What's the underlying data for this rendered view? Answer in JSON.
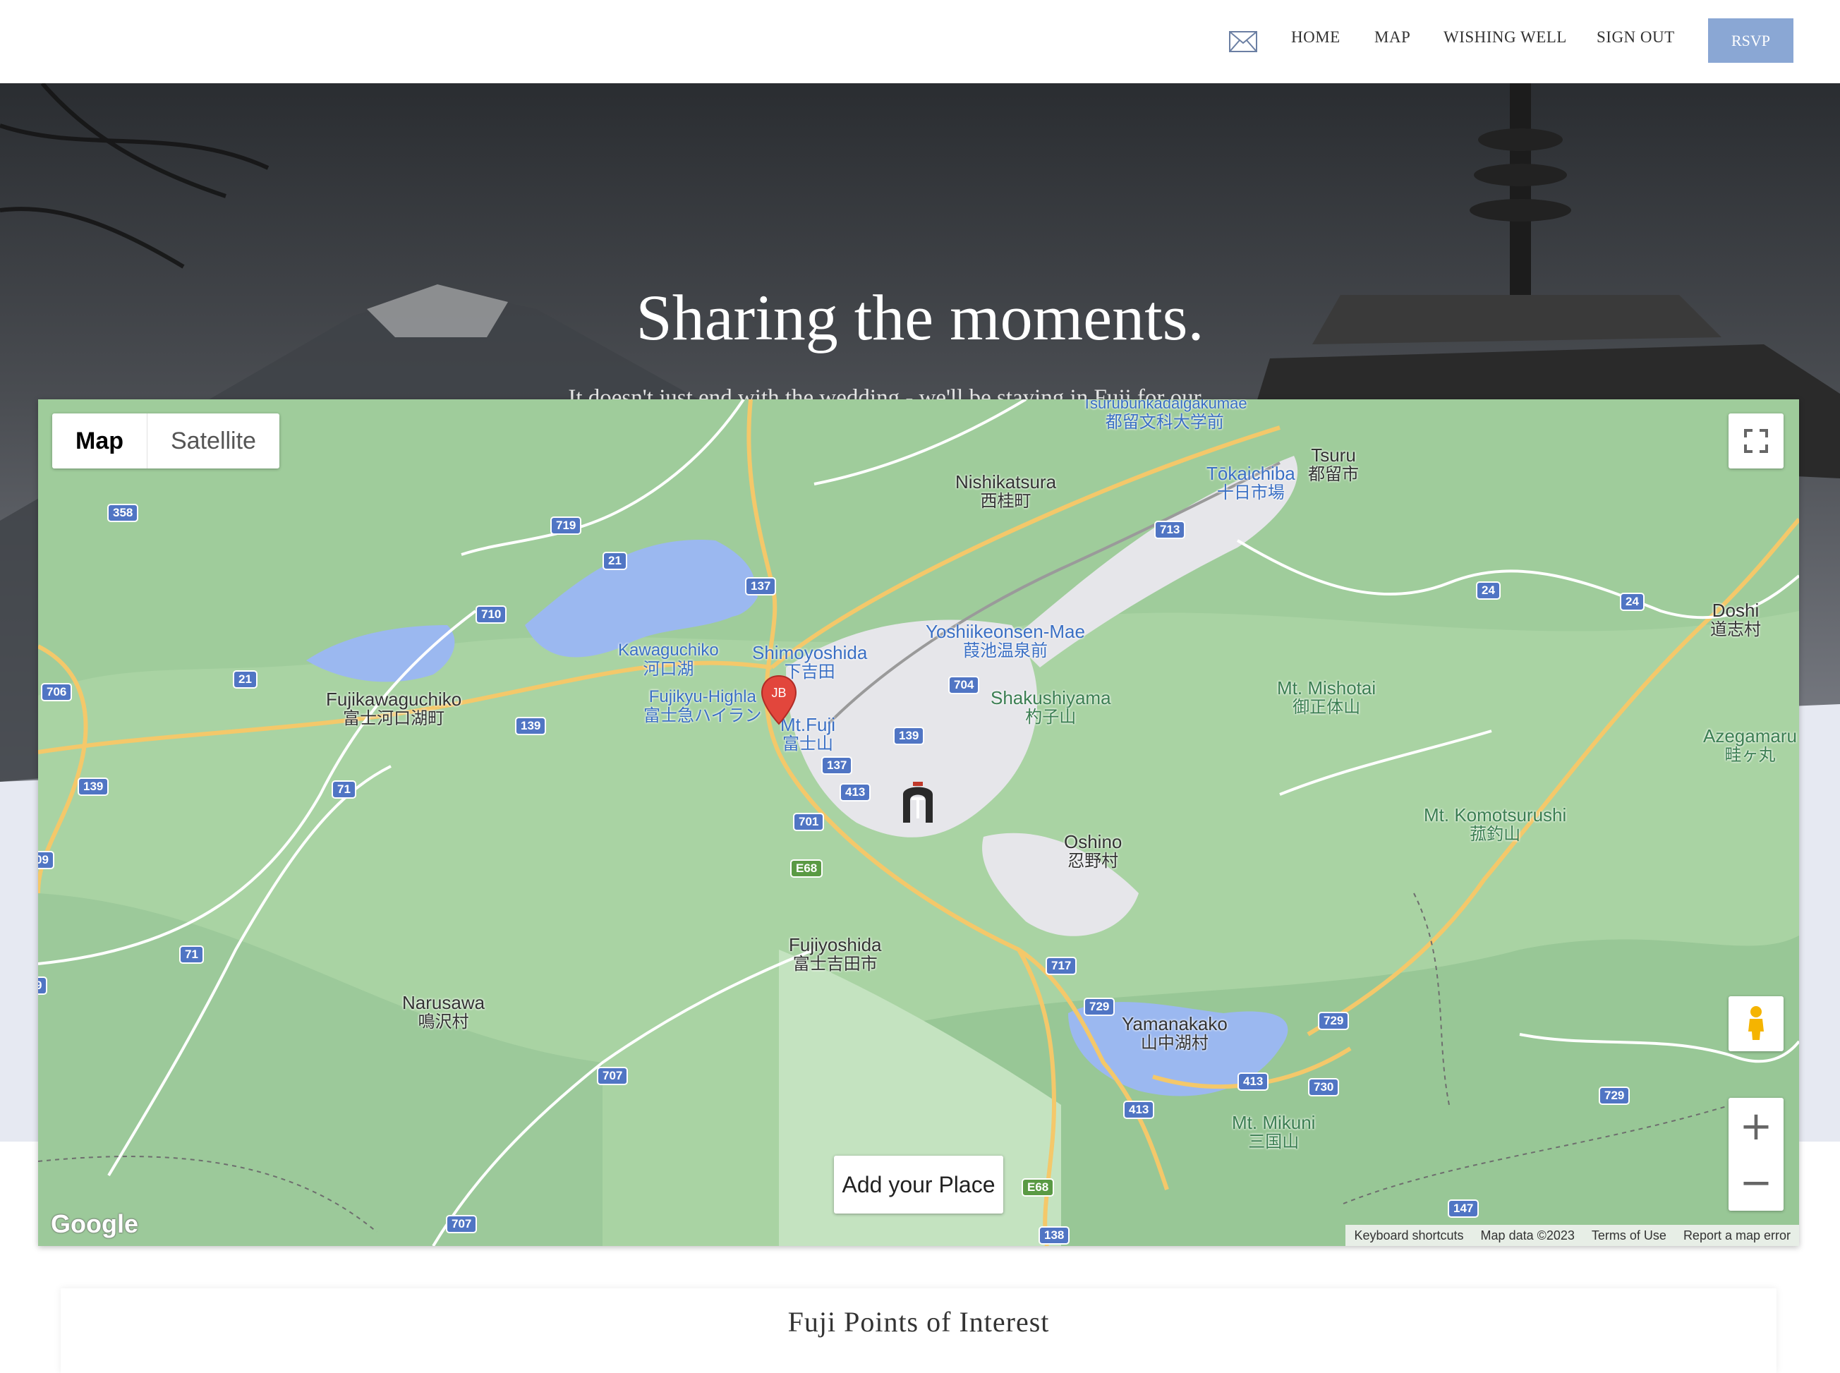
{
  "nav": {
    "mail_icon": "envelope-icon",
    "links": [
      "HOME",
      "MAP",
      "WISHING WELL",
      "SIGN OUT"
    ],
    "rsvp": "RSVP",
    "rsvp_color": "#8aa7d4"
  },
  "hero": {
    "title": "Sharing the moments.",
    "subtitle": "It doesn't just end with the wedding - we'll be staying in Fuji for our honeymoon. Here are our plans throughout our trip in Fuji."
  },
  "map": {
    "type_buttons": {
      "map": "Map",
      "satellite": "Satellite"
    },
    "add_place": "Add your Place",
    "logo": "Google",
    "attribution": [
      "Keyboard shortcuts",
      "Map data ©2023",
      "Terms of Use",
      "Report a map error"
    ],
    "marker_label": "JB",
    "marker_color": "#e2463c",
    "places": [
      {
        "en": "Nishikatsura",
        "jp": "西桂町"
      },
      {
        "en": "Tsuru",
        "jp": "都留市"
      },
      {
        "en": "Tōkaichiba",
        "jp": "十日市場"
      },
      {
        "en": "Tsurubunkadaigakumae",
        "jp": "都留文科大学前"
      },
      {
        "en": "Yoshiikeonsen-Mae",
        "jp": "葭池温泉前"
      },
      {
        "en": "Doshi",
        "jp": "道志村"
      },
      {
        "en": "Kawaguchiko",
        "jp": "河口湖"
      },
      {
        "en": "Shimoyoshida",
        "jp": "下吉田"
      },
      {
        "en": "Fujikyu-Highla",
        "jp": "富士急ハイラン"
      },
      {
        "en": "Mt.Fuji",
        "jp": "富士山"
      },
      {
        "en": "Fujikawaguchiko",
        "jp": "富士河口湖町"
      },
      {
        "en": "Shakushiyama",
        "jp": "杓子山"
      },
      {
        "en": "Mt. Mishotai",
        "jp": "御正体山"
      },
      {
        "en": "Azegamaru",
        "jp": "畦ヶ丸"
      },
      {
        "en": "Mt. Komotsurushi",
        "jp": "菰釣山"
      },
      {
        "en": "Oshino",
        "jp": "忍野村"
      },
      {
        "en": "Fujiyoshida",
        "jp": "富士吉田市"
      },
      {
        "en": "Narusawa",
        "jp": "鳴沢村"
      },
      {
        "en": "Yamanakako",
        "jp": "山中湖村"
      },
      {
        "en": "Mt. Mikuni",
        "jp": "三国山"
      }
    ],
    "routes": [
      "358",
      "719",
      "21",
      "710",
      "137",
      "706",
      "21",
      "139",
      "139",
      "71",
      "701",
      "E68",
      "413",
      "137",
      "139",
      "704",
      "713",
      "24",
      "24",
      "71",
      "717",
      "729",
      "729",
      "413",
      "730",
      "413",
      "729",
      "707",
      "707",
      "138",
      "147",
      "E68",
      "09",
      "9"
    ]
  },
  "poi": {
    "title": "Fuji Points of Interest"
  }
}
